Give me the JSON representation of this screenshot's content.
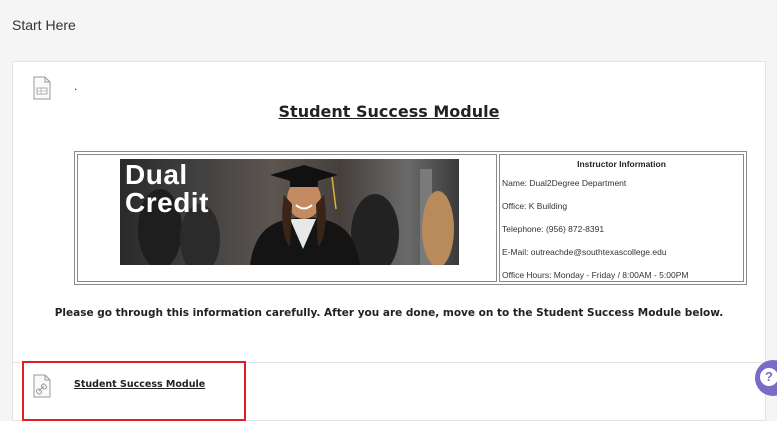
{
  "page": {
    "title": "Start Here"
  },
  "content_item": {
    "title_text": ".",
    "heading": "Student Success Module",
    "banner_line1": "Dual",
    "banner_line2": "Credit",
    "instructor": {
      "heading": "Instructor Information",
      "name": "Name: Dual2Degree Department",
      "office": "Office: K Building",
      "telephone": "Telephone: (956) 872-8391",
      "email": "E-Mail: outreachde@southtexascollege.edu",
      "hours": "Office Hours: Monday - Friday / 8:00AM - 5:00PM"
    },
    "instruction": "Please go through this information carefully. After you are done, move on to the Student Success Module below."
  },
  "link_item": {
    "label": "Student Success Module"
  },
  "colors": {
    "highlight": "#e02020",
    "help_button": "#7d6ac7"
  },
  "icons": {
    "document": "document-icon",
    "link": "link-icon",
    "help": "help-icon"
  }
}
